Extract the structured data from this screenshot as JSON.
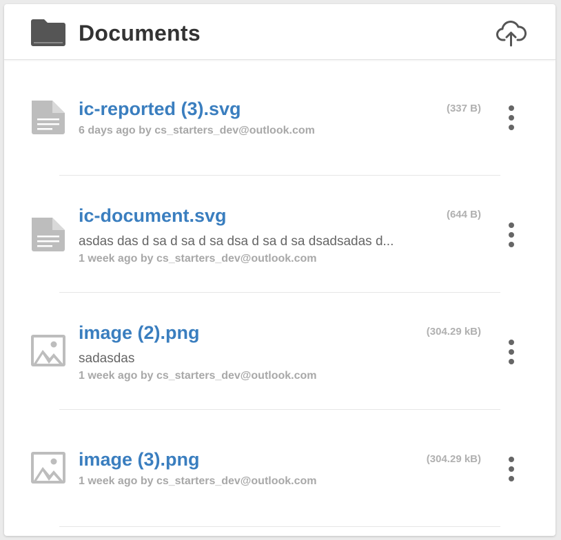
{
  "header": {
    "title": "Documents",
    "folder_icon": "folder-icon",
    "upload_icon": "cloud-upload-icon"
  },
  "documents": [
    {
      "name": "ic-reported (3).svg",
      "description": "",
      "meta": "6 days ago by cs_starters_dev@outlook.com",
      "size": "(337 B)",
      "icon": "file-text-icon"
    },
    {
      "name": "ic-document.svg",
      "description": "asdas das d sa d sa d sa dsa d sa d sa dsadsadas d...",
      "meta": "1 week ago by cs_starters_dev@outlook.com",
      "size": "(644 B)",
      "icon": "file-text-icon"
    },
    {
      "name": "image (2).png",
      "description": "sadasdas",
      "meta": "1 week ago by cs_starters_dev@outlook.com",
      "size": "(304.29 kB)",
      "icon": "image-icon"
    },
    {
      "name": "image (3).png",
      "description": "",
      "meta": "1 week ago by cs_starters_dev@outlook.com",
      "size": "(304.29 kB)",
      "icon": "image-icon"
    }
  ],
  "colors": {
    "link": "#3a7ebf",
    "icon_gray": "#bdbdbd",
    "folder": "#555555"
  }
}
